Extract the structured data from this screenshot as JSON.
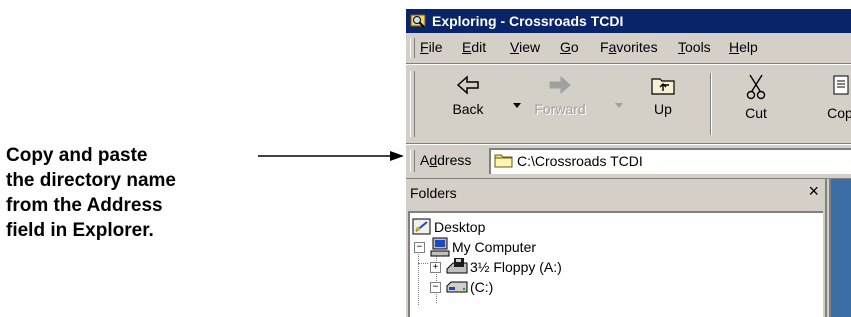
{
  "callout": {
    "lines": [
      "Copy and paste",
      "the directory name",
      "from the Address",
      "field in Explorer."
    ]
  },
  "window": {
    "title": "Exploring - Crossroads TCDI",
    "menu": [
      {
        "pre": "",
        "key": "F",
        "post": "ile"
      },
      {
        "pre": "",
        "key": "E",
        "post": "dit"
      },
      {
        "pre": "",
        "key": "V",
        "post": "iew"
      },
      {
        "pre": "",
        "key": "G",
        "post": "o"
      },
      {
        "pre": "F",
        "key": "a",
        "post": "vorites"
      },
      {
        "pre": "",
        "key": "T",
        "post": "ools"
      },
      {
        "pre": "",
        "key": "H",
        "post": "elp"
      }
    ],
    "toolbar": {
      "back": "Back",
      "forward": "Forward",
      "up": "Up",
      "cut": "Cut",
      "copy": "Cop"
    },
    "address": {
      "label_pre": "A",
      "label_key": "d",
      "label_post": "dress",
      "value": "C:\\Crossroads TCDI",
      "icon": "folder-icon"
    },
    "folders_pane": {
      "header": "Folders",
      "close": "×",
      "tree": [
        {
          "label": "Desktop",
          "icon": "desktop-icon"
        },
        {
          "label": "My Computer",
          "icon": "computer-icon",
          "expander": "−"
        },
        {
          "label": "3½ Floppy (A:)",
          "icon": "floppy-drive-icon",
          "expander": "+"
        },
        {
          "label": "(C:)",
          "icon": "hard-drive-icon",
          "expander": "−"
        }
      ]
    }
  }
}
